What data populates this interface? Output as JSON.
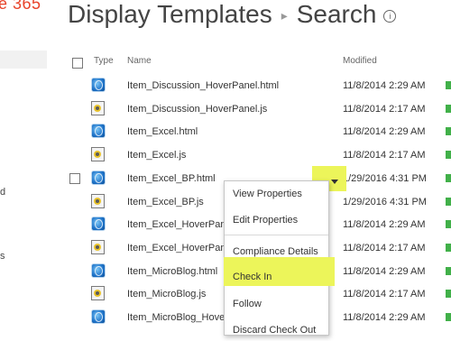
{
  "brand": "e 365",
  "left_nav": {
    "frag1": "d",
    "frag2": "s"
  },
  "page": {
    "title": "Display Templates",
    "subtitle": "Search",
    "info_glyph": "i"
  },
  "columns": {
    "type": "Type",
    "name": "Name",
    "modified": "Modified"
  },
  "rows": [
    {
      "name": "Item_Discussion_HoverPanel.html",
      "modified": "11/8/2014 2:29 AM",
      "icon": "html-icon"
    },
    {
      "name": "Item_Discussion_HoverPanel.js",
      "modified": "11/8/2014 2:17 AM",
      "icon": "js-icon"
    },
    {
      "name": "Item_Excel.html",
      "modified": "11/8/2014 2:29 AM",
      "icon": "html-icon"
    },
    {
      "name": "Item_Excel.js",
      "modified": "11/8/2014 2:17 AM",
      "icon": "js-icon"
    },
    {
      "name": "Item_Excel_BP.html",
      "modified": "1/29/2016 4:31 PM",
      "icon": "html-icon"
    },
    {
      "name": "Item_Excel_BP.js",
      "modified": "1/29/2016 4:31 PM",
      "icon": "js-icon"
    },
    {
      "name": "Item_Excel_HoverPane",
      "modified": "11/8/2014 2:29 AM",
      "icon": "html-icon"
    },
    {
      "name": "Item_Excel_HoverPane",
      "modified": "11/8/2014 2:17 AM",
      "icon": "js-icon"
    },
    {
      "name": "Item_MicroBlog.html",
      "modified": "11/8/2014 2:29 AM",
      "icon": "html-icon"
    },
    {
      "name": "Item_MicroBlog.js",
      "modified": "11/8/2014 2:17 AM",
      "icon": "js-icon"
    },
    {
      "name": "Item_MicroBlog_Hove",
      "modified": "11/8/2014 2:29 AM",
      "icon": "html-icon"
    }
  ],
  "context_menu": {
    "items": [
      "View Properties",
      "Edit Properties",
      "Compliance Details",
      "Check In",
      "Follow",
      "Discard Check Out"
    ],
    "highlighted": "Check In"
  },
  "colors": {
    "highlight": "#ecf55a",
    "status_bar": "#41b049",
    "brand": "#e8432a"
  }
}
